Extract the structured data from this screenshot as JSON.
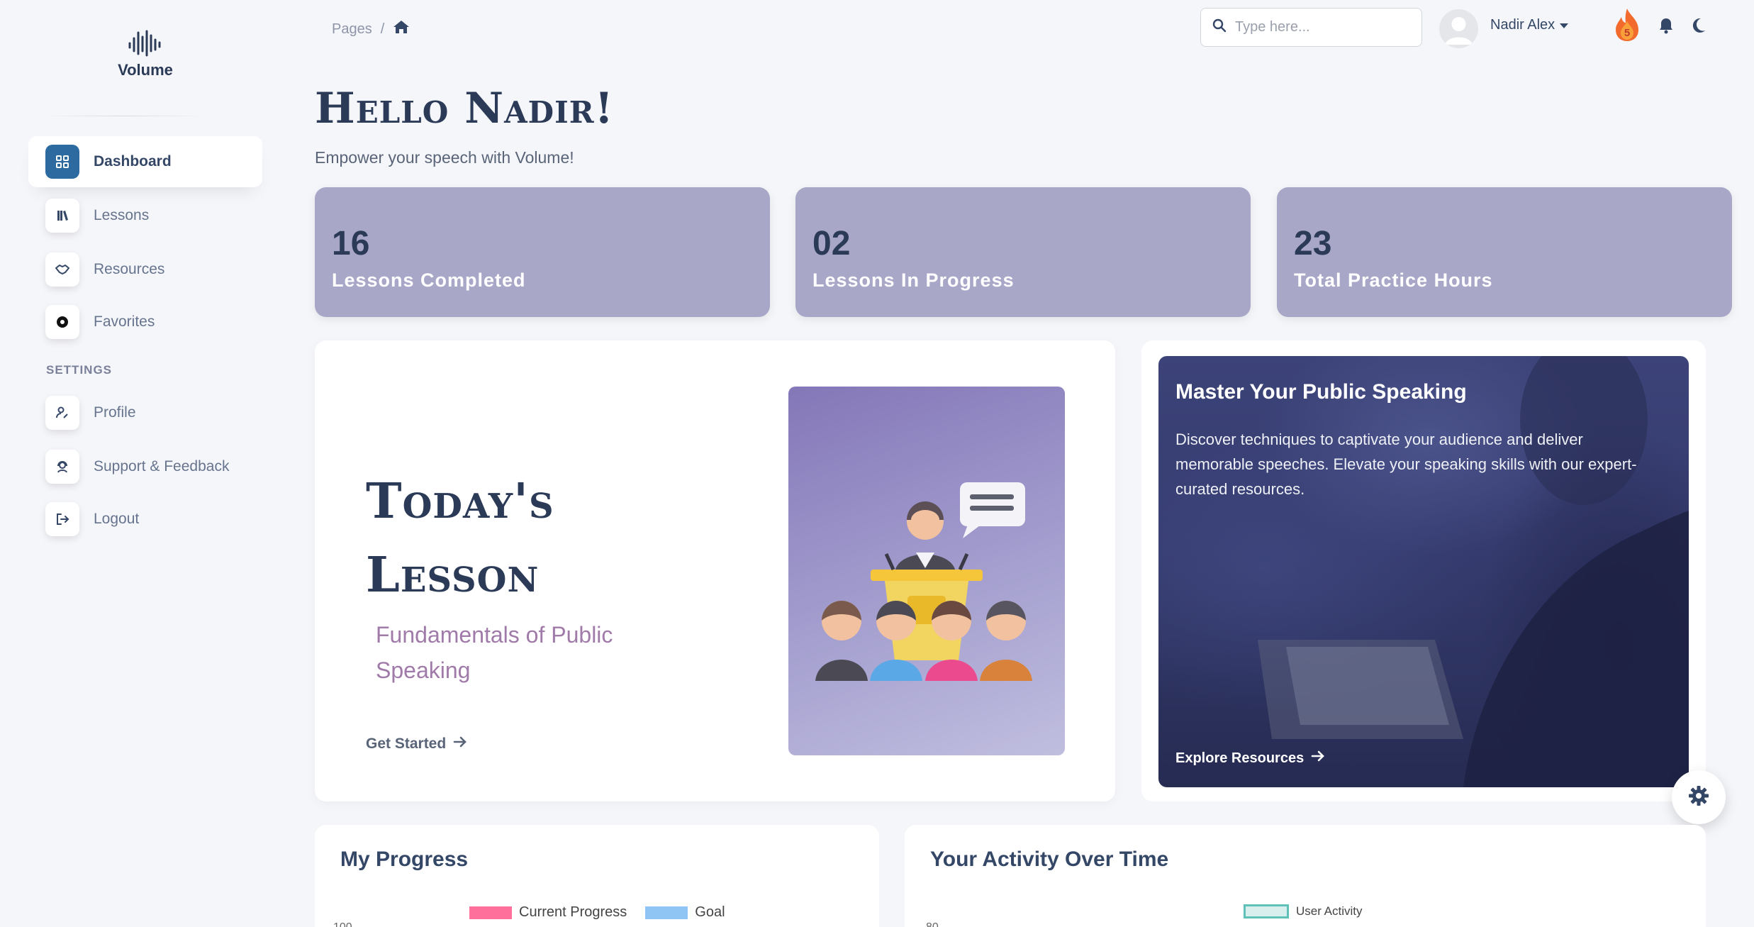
{
  "brand": {
    "name": "Volume"
  },
  "sidebar": {
    "items": [
      {
        "label": "Dashboard",
        "active": true
      },
      {
        "label": "Lessons"
      },
      {
        "label": "Resources"
      },
      {
        "label": "Favorites"
      }
    ],
    "section_title": "SETTINGS",
    "settings_items": [
      {
        "label": "Profile"
      },
      {
        "label": "Support & Feedback"
      },
      {
        "label": "Logout"
      }
    ]
  },
  "topbar": {
    "breadcrumb_root": "Pages",
    "breadcrumb_sep": "/",
    "search_placeholder": "Type here...",
    "user_name": "Nadir Alex",
    "streak_count": "5"
  },
  "header": {
    "greeting": "Hello Nadir!",
    "subtitle": "Empower your speech with Volume!"
  },
  "stats": [
    {
      "value": "16",
      "label": "Lessons Completed"
    },
    {
      "value": "02",
      "label": "Lessons In Progress"
    },
    {
      "value": "23",
      "label": "Total Practice Hours"
    }
  ],
  "lesson": {
    "title": "Today's Lesson",
    "topic": "Fundamentals of Public Speaking",
    "link": "Get Started"
  },
  "resources_card": {
    "title": "Master Your Public Speaking",
    "text": "Discover techniques to captivate your audience and deliver memorable speeches. Elevate your speaking skills with our expert-curated resources.",
    "link": "Explore Resources"
  },
  "progress_panel": {
    "title": "My Progress",
    "legend": [
      "Current Progress",
      "Goal"
    ],
    "y_tick_top": "100"
  },
  "activity_panel": {
    "title": "Your Activity Over Time",
    "legend": [
      "User Activity"
    ],
    "y_tick_top": "80"
  },
  "colors": {
    "accent": "#2c6aa0",
    "stat_card": "#a8a7c8",
    "current_progress": "#ff6f9c",
    "goal": "#8ec5f5",
    "user_activity": "#5fc1b8"
  }
}
